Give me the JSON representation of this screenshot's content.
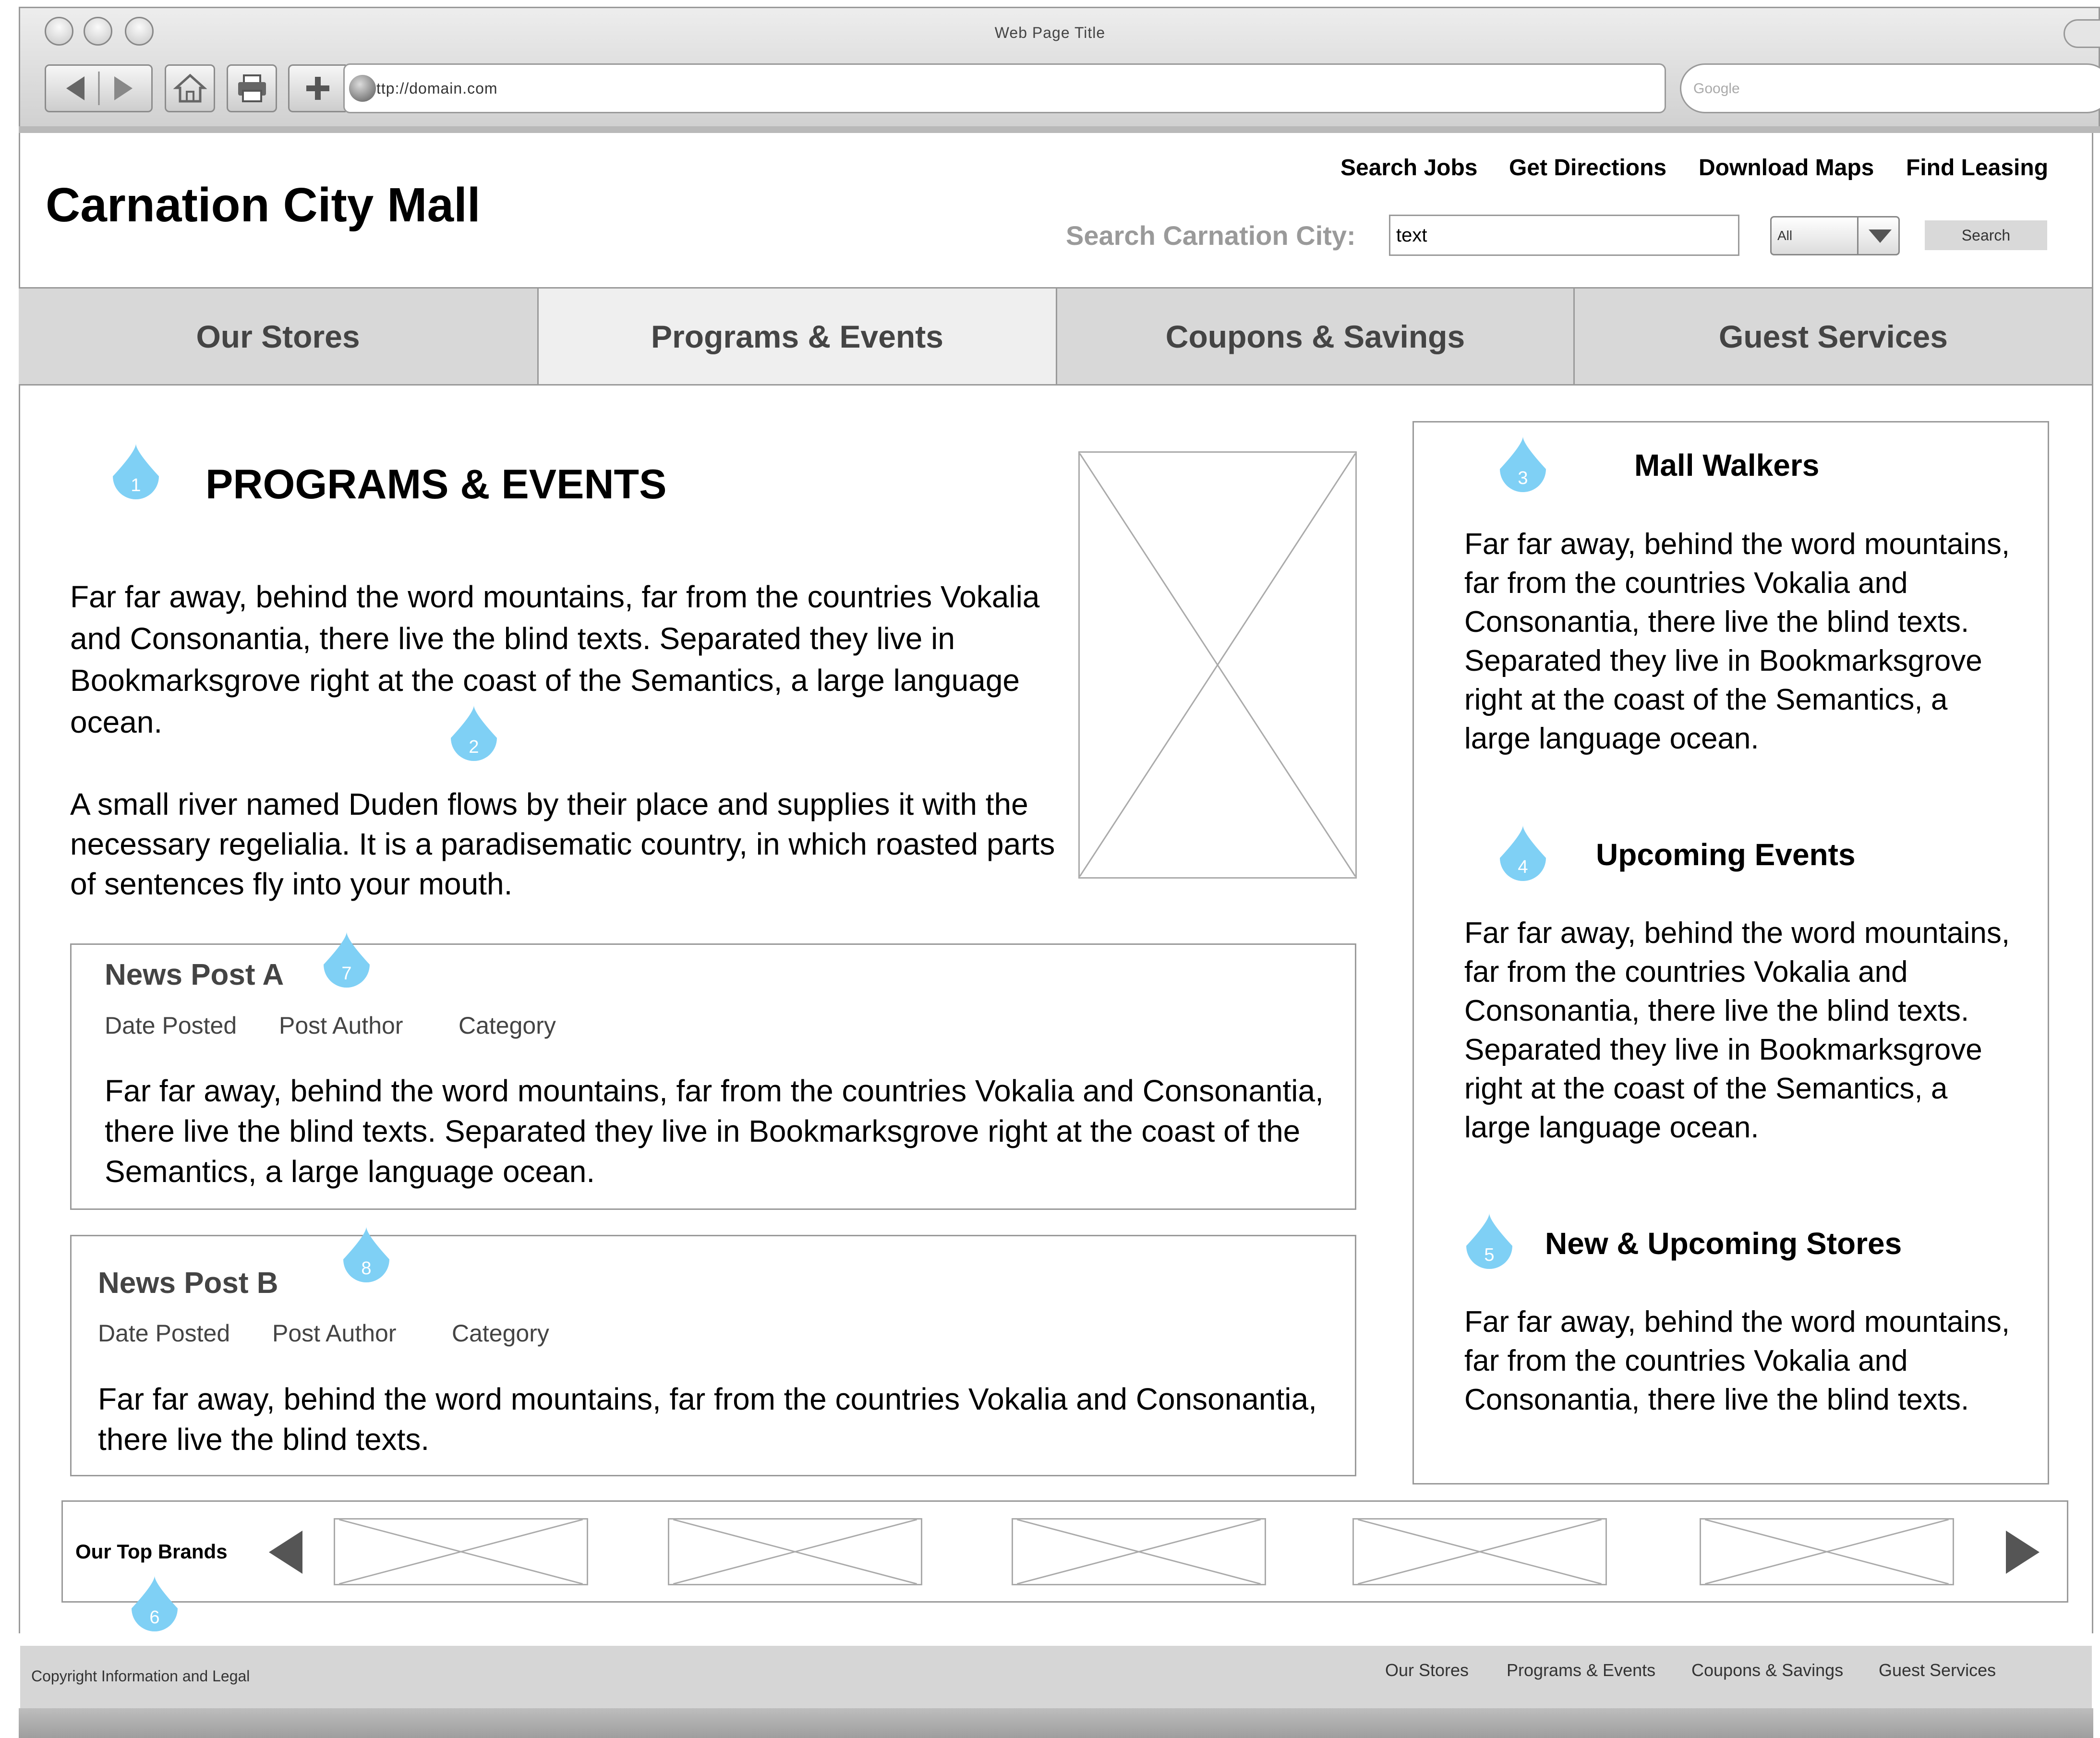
{
  "browser": {
    "window_title": "Web Page Title",
    "url": "ttp://domain.com",
    "search_placeholder": "Google",
    "icons": [
      "back-icon",
      "forward-icon",
      "home-icon",
      "print-icon",
      "add-icon",
      "globe-icon"
    ]
  },
  "header": {
    "site_title": "Carnation City Mall",
    "top_links": [
      "Search Jobs",
      "Get Directions",
      "Download Maps",
      "Find Leasing"
    ],
    "search_label": "Search Carnation City:",
    "search_value": "text",
    "select_value": "All",
    "search_button": "Search"
  },
  "nav": {
    "tabs": [
      "Our Stores",
      "Programs & Events",
      "Coupons & Savings",
      "Guest Services"
    ],
    "active": "Programs & Events"
  },
  "main": {
    "heading": "PROGRAMS & EVENTS",
    "intro_p1": "Far far away, behind the word mountains, far from the countries Vokalia and Consonantia, there live the blind texts. Separated they live in Bookmarksgrove right at the coast of the Semantics, a large language ocean.",
    "intro_p2": "A small river named Duden flows by their place and supplies it with the necessary regelialia. It is a paradisematic country, in which roasted parts of sentences fly into your mouth."
  },
  "posts": [
    {
      "title": "News Post A",
      "date": "Date Posted",
      "author": "Post Author",
      "category": "Category",
      "body": "Far far away, behind the word mountains, far from the countries Vokalia and Consonantia, there live the blind texts. Separated they live in Bookmarksgrove right at the coast of the Semantics, a large language ocean."
    },
    {
      "title": "News Post B",
      "date": "Date Posted",
      "author": "Post Author",
      "category": "Category",
      "body": "Far far away, behind the word mountains, far from the countries Vokalia and Consonantia, there live the blind texts."
    }
  ],
  "sidebar": {
    "sections": [
      {
        "title": "Mall Walkers",
        "text": "Far far away, behind the word mountains, far from the countries Vokalia and Consonantia, there live the blind texts. Separated they live in Bookmarksgrove right at the coast of the Semantics, a large language ocean."
      },
      {
        "title": "Upcoming Events",
        "text": "Far far away, behind the word mountains, far from the countries Vokalia and Consonantia, there live the blind texts. Separated they live in Bookmarksgrove right at the coast of the Semantics, a large language ocean."
      },
      {
        "title": "New & Upcoming Stores",
        "text": "Far far away, behind the word mountains, far from the countries Vokalia and Consonantia, there live the blind texts."
      }
    ]
  },
  "brands": {
    "label": "Our Top Brands"
  },
  "footer": {
    "copyright": "Copyright Information and Legal",
    "links": [
      "Our Stores",
      "Programs & Events",
      "Coupons & Savings",
      "Guest Services"
    ]
  },
  "callouts": [
    "1",
    "2",
    "3",
    "4",
    "5",
    "6",
    "7",
    "8"
  ],
  "colors": {
    "callout": "#7fd0f5",
    "border": "#9a9a9a",
    "nav_bg": "#d8d8d8",
    "nav_active_bg": "#efefef",
    "footer_bg": "#d6d6d6"
  }
}
